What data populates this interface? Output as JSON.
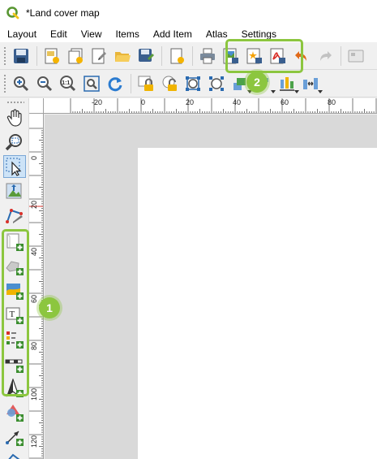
{
  "window": {
    "title": "*Land cover map"
  },
  "menubar": {
    "items": [
      "Layout",
      "Edit",
      "View",
      "Items",
      "Add Item",
      "Atlas",
      "Settings"
    ]
  },
  "toolbar_main": {
    "buttons": [
      {
        "icon": "save-icon",
        "label": "Save Project"
      },
      {
        "icon": "new-layout-icon",
        "label": "New Layout"
      },
      {
        "icon": "duplicate-layout-icon",
        "label": "Duplicate Layout"
      },
      {
        "icon": "layout-manager-icon",
        "label": "Layout Manager"
      },
      {
        "icon": "open-folder-icon",
        "label": "Add Items from Template"
      },
      {
        "icon": "save-as-template-icon",
        "label": "Save as Template"
      },
      {
        "icon": "new-page-icon",
        "label": "Add Pages"
      },
      {
        "icon": "print-icon",
        "label": "Print"
      },
      {
        "icon": "export-image-icon",
        "label": "Export as Image"
      },
      {
        "icon": "export-svg-icon",
        "label": "Export as SVG"
      },
      {
        "icon": "export-pdf-icon",
        "label": "Export as PDF"
      },
      {
        "icon": "undo-icon",
        "label": "Undo"
      },
      {
        "icon": "redo-icon",
        "label": "Redo"
      }
    ]
  },
  "toolbar_view": {
    "buttons": [
      {
        "icon": "zoom-in-icon"
      },
      {
        "icon": "zoom-out-icon"
      },
      {
        "icon": "zoom-actual-icon",
        "label": "1:1"
      },
      {
        "icon": "zoom-full-icon"
      },
      {
        "icon": "refresh-icon"
      },
      {
        "icon": "lock-items-icon"
      },
      {
        "icon": "unlock-items-icon"
      },
      {
        "icon": "group-items-icon"
      },
      {
        "icon": "ungroup-items-icon"
      },
      {
        "icon": "raise-items-icon"
      },
      {
        "icon": "align-left-icon"
      },
      {
        "icon": "distribute-icon"
      },
      {
        "icon": "resize-icon"
      }
    ]
  },
  "toolbox": {
    "tools": [
      {
        "icon": "pan-icon"
      },
      {
        "icon": "zoom-tool-icon"
      },
      {
        "icon": "select-move-icon",
        "active": true
      },
      {
        "icon": "move-content-icon"
      },
      {
        "icon": "edit-nodes-icon"
      },
      {
        "icon": "add-map-icon"
      },
      {
        "icon": "add-3d-map-icon"
      },
      {
        "icon": "add-picture-icon"
      },
      {
        "icon": "add-label-icon",
        "label": "T"
      },
      {
        "icon": "add-legend-icon"
      },
      {
        "icon": "add-scalebar-icon"
      },
      {
        "icon": "add-north-arrow-icon"
      },
      {
        "icon": "add-shape-icon"
      },
      {
        "icon": "add-arrow-icon"
      },
      {
        "icon": "add-node-item-icon"
      }
    ]
  },
  "rulers": {
    "horizontal_labels": [
      "-20",
      "0",
      "20",
      "40",
      "60",
      "80"
    ],
    "vertical_labels": [
      "0",
      "20",
      "40",
      "60",
      "80",
      "100",
      "120"
    ]
  },
  "annotations": {
    "callout_1": "1",
    "callout_2": "2",
    "highlight_color": "#8cc63f"
  },
  "colors": {
    "canvas": "#d9d9d9",
    "paper": "#ffffff",
    "accent": "#8cc63f"
  }
}
